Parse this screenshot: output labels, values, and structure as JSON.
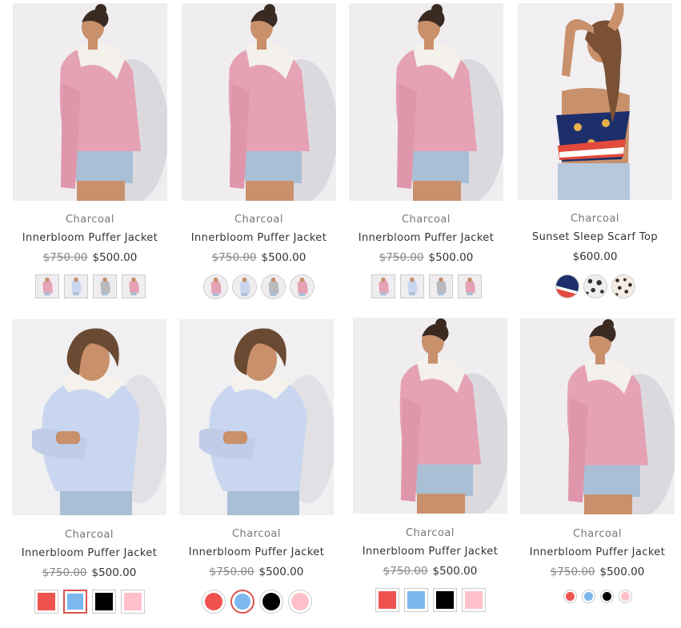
{
  "products": [
    {
      "brand": "Charcoal",
      "name": "Innerbloom Puffer Jacket",
      "old_price": "$750.00",
      "price": "$500.00",
      "photo": "pink-jacket",
      "swatch_style": "image-square",
      "swatches": [
        {
          "kind": "pink-jacket"
        },
        {
          "kind": "blue-jacket"
        },
        {
          "kind": "grey-jacket"
        },
        {
          "kind": "pink-jacket"
        }
      ]
    },
    {
      "brand": "Charcoal",
      "name": "Innerbloom Puffer Jacket",
      "old_price": "$750.00",
      "price": "$500.00",
      "photo": "pink-jacket",
      "swatch_style": "image-round",
      "swatches": [
        {
          "kind": "pink-jacket"
        },
        {
          "kind": "blue-jacket"
        },
        {
          "kind": "grey-jacket"
        },
        {
          "kind": "pink-jacket"
        }
      ]
    },
    {
      "brand": "Charcoal",
      "name": "Innerbloom Puffer Jacket",
      "old_price": "$750.00",
      "price": "$500.00",
      "photo": "pink-jacket",
      "swatch_style": "image-square",
      "swatches": [
        {
          "kind": "pink-jacket"
        },
        {
          "kind": "blue-jacket"
        },
        {
          "kind": "grey-jacket"
        },
        {
          "kind": "pink-jacket"
        }
      ]
    },
    {
      "brand": "Charcoal",
      "name": "Sunset Sleep Scarf Top",
      "old_price": "",
      "price": "$600.00",
      "photo": "scarf-top",
      "swatch_style": "pattern-round",
      "swatches": [
        {
          "kind": "flag"
        },
        {
          "kind": "dots-white"
        },
        {
          "kind": "leopard"
        }
      ]
    },
    {
      "brand": "Charcoal",
      "name": "Innerbloom Puffer Jacket",
      "old_price": "$750.00",
      "price": "$500.00",
      "photo": "blue-jacket",
      "swatch_style": "color-square",
      "swatches": [
        {
          "color": "#ef5350"
        },
        {
          "color": "#7cb7ee",
          "selected": true
        },
        {
          "color": "#000000"
        },
        {
          "color": "#ffc0cb"
        }
      ]
    },
    {
      "brand": "Charcoal",
      "name": "Innerbloom Puffer Jacket",
      "old_price": "$750.00",
      "price": "$500.00",
      "photo": "blue-jacket",
      "swatch_style": "color-round",
      "swatches": [
        {
          "color": "#ef5350"
        },
        {
          "color": "#7cb7ee",
          "selected": true
        },
        {
          "color": "#000000"
        },
        {
          "color": "#ffc0cb"
        }
      ]
    },
    {
      "brand": "Charcoal",
      "name": "Innerbloom Puffer Jacket",
      "old_price": "$750.00",
      "price": "$500.00",
      "photo": "pink-jacket",
      "swatch_style": "color-square",
      "swatches": [
        {
          "color": "#ef5350"
        },
        {
          "color": "#7cb7ee"
        },
        {
          "color": "#000000"
        },
        {
          "color": "#ffc0cb"
        }
      ]
    },
    {
      "brand": "Charcoal",
      "name": "Innerbloom Puffer Jacket",
      "old_price": "$750.00",
      "price": "$500.00",
      "photo": "pink-jacket",
      "swatch_style": "color-round-small",
      "swatches": [
        {
          "color": "#ef5350"
        },
        {
          "color": "#7cb7ee"
        },
        {
          "color": "#000000"
        },
        {
          "color": "#ffc0cb"
        }
      ]
    }
  ]
}
